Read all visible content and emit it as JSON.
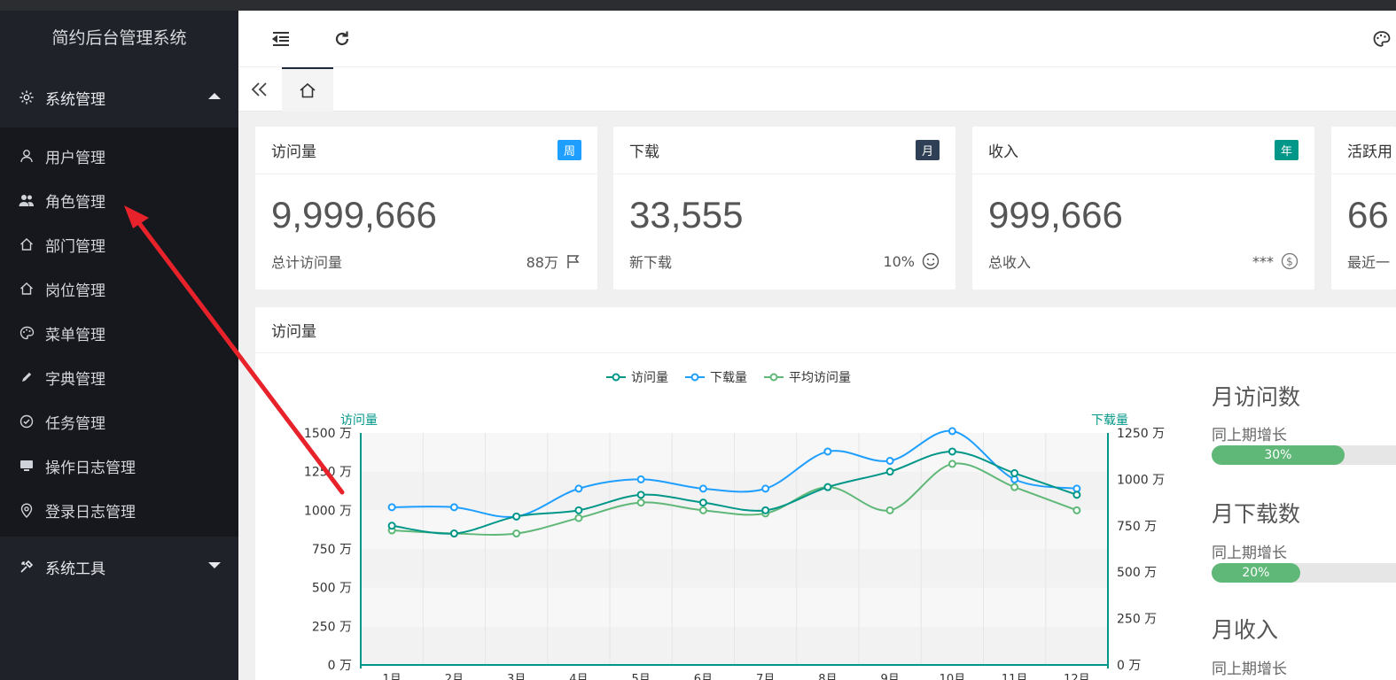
{
  "app": {
    "title": "简约后台管理系统"
  },
  "sidebar": {
    "group_system": "系统管理",
    "items": [
      {
        "label": "用户管理",
        "icon": "user-icon"
      },
      {
        "label": "角色管理",
        "icon": "users-icon"
      },
      {
        "label": "部门管理",
        "icon": "home-icon"
      },
      {
        "label": "岗位管理",
        "icon": "home-icon"
      },
      {
        "label": "菜单管理",
        "icon": "palette-icon"
      },
      {
        "label": "字典管理",
        "icon": "pencil-icon"
      },
      {
        "label": "任务管理",
        "icon": "check-circle-icon"
      },
      {
        "label": "操作日志管理",
        "icon": "monitor-icon"
      },
      {
        "label": "登录日志管理",
        "icon": "location-icon"
      }
    ],
    "group_tools": "系统工具"
  },
  "cards": [
    {
      "title": "访问量",
      "badge": "周",
      "badge_color": "#1e9fff",
      "value": "9,999,666",
      "label": "总计访问量",
      "extra": "88万",
      "extra_icon": "flag-icon"
    },
    {
      "title": "下载",
      "badge": "月",
      "badge_color": "#2f4056",
      "value": "33,555",
      "label": "新下载",
      "extra": "10%",
      "extra_icon": "smile-icon"
    },
    {
      "title": "收入",
      "badge": "年",
      "badge_color": "#009688",
      "value": "999,666",
      "label": "总收入",
      "extra": "***",
      "extra_icon": "dollar-icon"
    },
    {
      "title": "活跃用",
      "value": "66",
      "label": "最近一"
    }
  ],
  "panel": {
    "title": "访问量"
  },
  "chart_data": {
    "type": "line",
    "legend": [
      "访问量",
      "下载量",
      "平均访问量"
    ],
    "ylabel_left": "访问量",
    "ylabel_right": "下载量",
    "y_left_ticks": [
      "0 万",
      "250 万",
      "500 万",
      "750 万",
      "1000 万",
      "1250 万",
      "1500 万"
    ],
    "y_right_ticks": [
      "0 万",
      "250 万",
      "500 万",
      "750 万",
      "1000 万",
      "1250 万"
    ],
    "ylim_left": [
      0,
      1500
    ],
    "ylim_right": [
      0,
      1250
    ],
    "categories": [
      "1月",
      "2月",
      "3月",
      "4月",
      "5月",
      "6月",
      "7月",
      "8月",
      "9月",
      "10月",
      "11月",
      "12月"
    ],
    "series": [
      {
        "name": "访问量",
        "axis": "left",
        "color": "#009688",
        "values": [
          900,
          850,
          960,
          1000,
          1100,
          1050,
          1000,
          1150,
          1250,
          1380,
          1240,
          1100
        ]
      },
      {
        "name": "下载量",
        "axis": "right",
        "color": "#1e9fff",
        "values": [
          850,
          850,
          800,
          950,
          1000,
          950,
          950,
          1150,
          1100,
          1260,
          1000,
          950
        ]
      },
      {
        "name": "平均访问量",
        "axis": "left",
        "color": "#5fb878",
        "values": [
          870,
          850,
          850,
          950,
          1050,
          1000,
          980,
          1150,
          1000,
          1300,
          1150,
          1000
        ]
      }
    ]
  },
  "right_stats": [
    {
      "title": "月访问数",
      "sub": "同上期增长",
      "percent": 30,
      "percent_label": "30%"
    },
    {
      "title": "月下载数",
      "sub": "同上期增长",
      "percent": 20,
      "percent_label": "20%"
    },
    {
      "title": "月收入",
      "sub": "同上期增长"
    }
  ]
}
